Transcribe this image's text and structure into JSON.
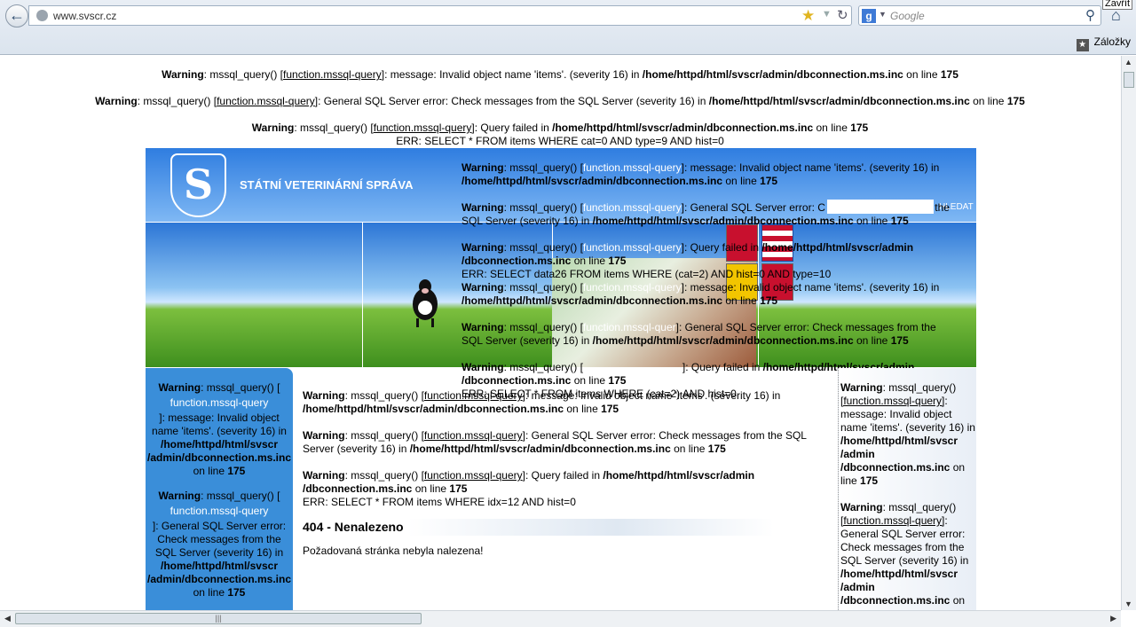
{
  "browser": {
    "url": "www.svscr.cz",
    "search_placeholder": "Google",
    "bookmarks_label": "Záložky",
    "close_tooltip": "Zavřít"
  },
  "top_warnings": {
    "w1_word": "Warning",
    "w1_pre": ": mssql_query() [",
    "w1_link": "function.mssql-query",
    "w1_mid": "]: message: Invalid object name 'items'. (severity 16) in ",
    "w1_path": "/home/httpd/html/svscr/admin/dbconnection.ms.inc",
    "w1_online": " on line ",
    "w1_line": "175",
    "w2_word": "Warning",
    "w2_pre": ": mssql_query() [",
    "w2_link": "function.mssql-query",
    "w2_mid": "]: General SQL Server error: Check messages from the SQL Server (severity 16) in ",
    "w2_path": "/home/httpd/html/svscr/admin/dbconnection.ms.inc",
    "w2_online": " on line ",
    "w2_line": "175",
    "w3_word": "Warning",
    "w3_pre": ": mssql_query() [",
    "w3_link": "function.mssql-query",
    "w3_mid": "]: Query failed in ",
    "w3_path": "/home/httpd/html/svscr/admin/dbconnection.ms.inc",
    "w3_online": " on line ",
    "w3_line": "175",
    "err": "ERR: SELECT * FROM items WHERE cat=0 AND type=9 AND hist=0"
  },
  "site": {
    "title": "STÁTNÍ VETERINÁRNÍ SPRÁVA",
    "logo_glyph": "S",
    "search_button": "HLEDAT"
  },
  "banner_warnings": {
    "a_word": "Warning",
    "a_pre": ": mssql_query() [",
    "a_link": "function.mssql-query",
    "a_mid": "]: message: Invalid object name 'items'. (severity 16) in",
    "a_path": "/home/httpd/html/svscr/admin/dbconnection.ms.inc",
    "a_online": " on line ",
    "a_line": "175",
    "b_word": "Warning",
    "b_pre": ": mssql_query() [",
    "b_link": "function.mssql-query",
    "b_mid": "]: General SQL Server error: C",
    "b_tail": " the",
    "b_line2": "SQL Server (severity 16) in ",
    "b_path": "/home/httpd/html/svscr/admin/dbconnection.ms.inc",
    "b_online": " on line ",
    "b_line": "175",
    "c_word": "Warning",
    "c_pre": ": mssql_query() [",
    "c_link": "function.mssql-query",
    "c_mid": "]: Query failed in ",
    "c_path1": "/home/httpd/html/svscr/admin",
    "c_path2": "/dbconnection.ms.inc",
    "c_online": " on line ",
    "c_line": "175",
    "c_err": "ERR: SELECT data26 FROM items WHERE (cat=2) AND hist=0 AND type=10",
    "d_word": "Warning",
    "d_pre": ": mssql_query() [",
    "d_link": "function.mssql-query",
    "d_mid": "]: message: Invalid object name 'items'. (severity 16) in",
    "d_path": "/home/httpd/html/svscr/admin/dbconnection.ms.inc",
    "d_online": " on line ",
    "d_line": "175",
    "e_word": "Warning",
    "e_pre": ": mssql_query() [",
    "e_link": "function.mssql-quer",
    "e_mid": "]: General SQL Server error: Check messages from the",
    "e_line2": "SQL Server (severity 16) in ",
    "e_path": "/home/httpd/html/svscr/admin/dbconnection.ms.inc",
    "e_online": " on line ",
    "e_line": "175",
    "f_word": "Warning",
    "f_pre": ": mssql_query() [",
    "f_mid": "]: Query failed in ",
    "f_path1": "/home/httpd/html/svscr/admin",
    "f_path2": "/dbconnection.ms.inc",
    "f_online": " on line ",
    "f_line": "175",
    "f_err": "ERR: SELECT * FROM items WHERE (cat=2) AND hist=0"
  },
  "left_sidebar": {
    "a_word": "Warning",
    "a_pre": ": mssql_query() [",
    "a_link": "function.mssql-query",
    "a_mid": "]: message: Invalid object name 'items'. (severity 16) in",
    "a_path1": "/home/httpd/html/svscr",
    "a_path2": "/admin/dbconnection.ms.inc",
    "a_online": "on line ",
    "a_line": "175",
    "b_word": "Warning",
    "b_pre": ": mssql_query() [",
    "b_link": "function.mssql-query",
    "b_mid": "]: General SQL Server error: Check messages from the SQL Server (severity 16) in",
    "b_path1": "/home/httpd/html/svscr",
    "b_path2": "/admin/dbconnection.ms.inc",
    "b_online": "on line ",
    "b_line": "175"
  },
  "main": {
    "a_word": "Warning",
    "a_pre": ": mssql_query() [",
    "a_link": "function.mssql-query",
    "a_mid": "]: message: Invalid object name 'items'. (severity 16) in",
    "a_path": "/home/httpd/html/svscr/admin/dbconnection.ms.inc",
    "a_online": " on line ",
    "a_line": "175",
    "b_word": "Warning",
    "b_pre": ": mssql_query() [",
    "b_link": "function.mssql-query",
    "b_mid": "]: General SQL Server error: Check messages from the SQL Server (severity 16) in ",
    "b_path": "/home/httpd/html/svscr/admin/dbconnection.ms.inc",
    "b_online": " on line ",
    "b_line": "175",
    "c_word": "Warning",
    "c_pre": ": mssql_query() [",
    "c_link": "function.mssql-query",
    "c_mid": "]: Query failed in ",
    "c_path1": "/home/httpd/html/svscr/admin",
    "c_path2": "/dbconnection.ms.inc",
    "c_online": " on line ",
    "c_line": "175",
    "c_err": "ERR: SELECT * FROM items WHERE idx=12 AND hist=0",
    "notfound_title": "404 - Nenalezeno",
    "notfound_text": "Požadovaná stránka nebyla nalezena!"
  },
  "right_sidebar": {
    "a_word": "Warning",
    "a_pre": ": mssql_query()",
    "a_link": "[function.mssql-query]",
    "a_mid": ": message: Invalid object name 'items'. (severity 16) in ",
    "a_path1": "/home/httpd/html/svscr",
    "a_path2": "/admin",
    "a_path3": "/dbconnection.ms.inc",
    "a_online": " on line ",
    "a_line": "175",
    "b_word": "Warning",
    "b_pre": ": mssql_query()",
    "b_link": "[function.mssql-query]",
    "b_mid": ": General SQL Server error: Check messages from the SQL Server (severity 16) in ",
    "b_path1": "/home/httpd/html/svscr",
    "b_path2": "/admin",
    "b_path3": "/dbconnection.ms.inc",
    "b_online": " on"
  },
  "colors": {
    "header_blue": "#2f7de0",
    "sidebar_blue": "#3a8ed9"
  }
}
